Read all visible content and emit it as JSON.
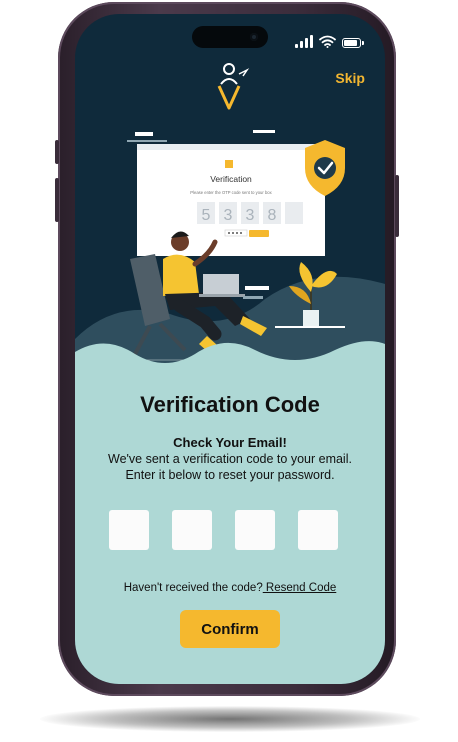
{
  "header": {
    "skip_label": "Skip"
  },
  "illustration": {
    "card_title": "Verification",
    "card_hint": "Please enter the OTP code sent to your box",
    "card_digits": [
      "5",
      "3",
      "3",
      "8",
      ""
    ]
  },
  "main": {
    "title": "Verification Code",
    "subtitle": "Check Your Email!",
    "description": "We've sent a verification code to your email. Enter it below to reset your password.",
    "otp": [
      {
        "value": "",
        "placeholder": ""
      },
      {
        "value": "",
        "placeholder": ""
      },
      {
        "value": "",
        "placeholder": ""
      },
      {
        "value": "",
        "placeholder": ""
      }
    ],
    "resend_prompt": "Haven't received the code?",
    "resend_link": " Resend Code",
    "confirm_label": "Confirm"
  },
  "colors": {
    "background_dark": "#0f2a3b",
    "panel": "#aed8d5",
    "accent": "#f5b82e",
    "phone_frame": "#3c2d3c"
  },
  "icons": [
    "signal-icon",
    "wifi-icon",
    "battery-icon",
    "logo-icon",
    "shield-check-icon"
  ]
}
